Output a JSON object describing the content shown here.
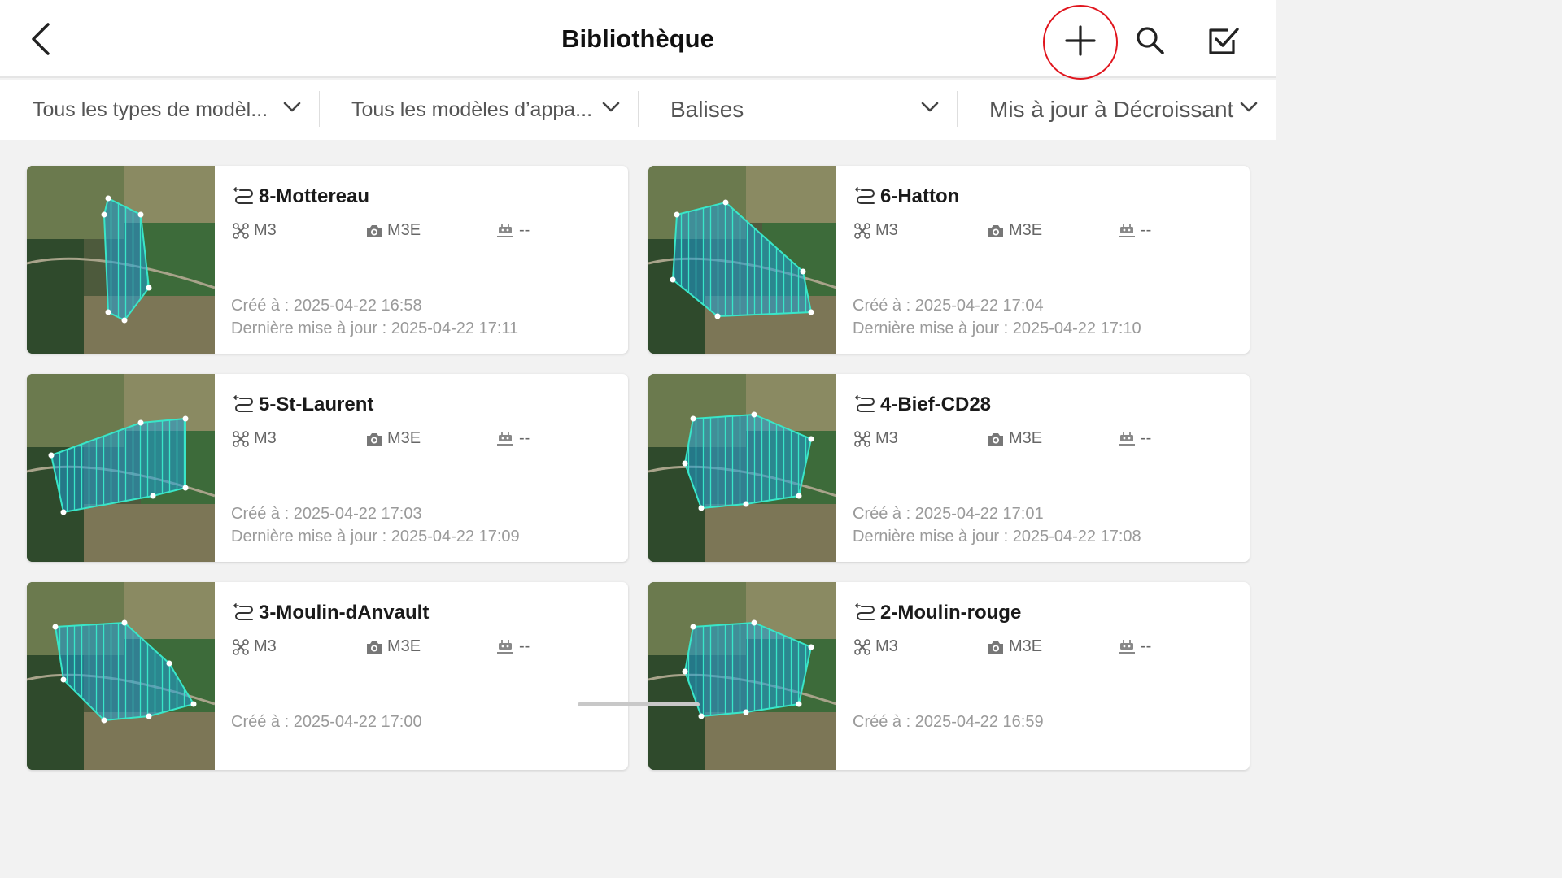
{
  "header": {
    "title": "Bibliothèque",
    "highlight_color": "#e0151d"
  },
  "filters": [
    {
      "label": "Tous les types de modèl..."
    },
    {
      "label": "Tous les modèles d’appa..."
    },
    {
      "label": "Balises"
    },
    {
      "label": "Mis à jour à Décroissant"
    }
  ],
  "labels": {
    "created_prefix": "Créé à : ",
    "updated_prefix": "Dernière mise à jour : "
  },
  "missions": [
    {
      "name": "8-Mottereau",
      "drone": "M3",
      "camera": "M3E",
      "payload": "--",
      "created": "2025-04-22 16:58",
      "updated": "2025-04-22 17:11"
    },
    {
      "name": "6-Hatton",
      "drone": "M3",
      "camera": "M3E",
      "payload": "--",
      "created": "2025-04-22 17:04",
      "updated": "2025-04-22 17:10"
    },
    {
      "name": "5-St-Laurent",
      "drone": "M3",
      "camera": "M3E",
      "payload": "--",
      "created": "2025-04-22 17:03",
      "updated": "2025-04-22 17:09"
    },
    {
      "name": "4-Bief-CD28",
      "drone": "M3",
      "camera": "M3E",
      "payload": "--",
      "created": "2025-04-22 17:01",
      "updated": "2025-04-22 17:08"
    },
    {
      "name": "3-Moulin-dAnvault",
      "drone": "M3",
      "camera": "M3E",
      "payload": "--",
      "created": "2025-04-22 17:00",
      "updated": ""
    },
    {
      "name": "2-Moulin-rouge",
      "drone": "M3",
      "camera": "M3E",
      "payload": "--",
      "created": "2025-04-22 16:59",
      "updated": ""
    }
  ],
  "colors": {
    "route_fill": "#1e9fd6",
    "route_line": "#39e6c8"
  }
}
